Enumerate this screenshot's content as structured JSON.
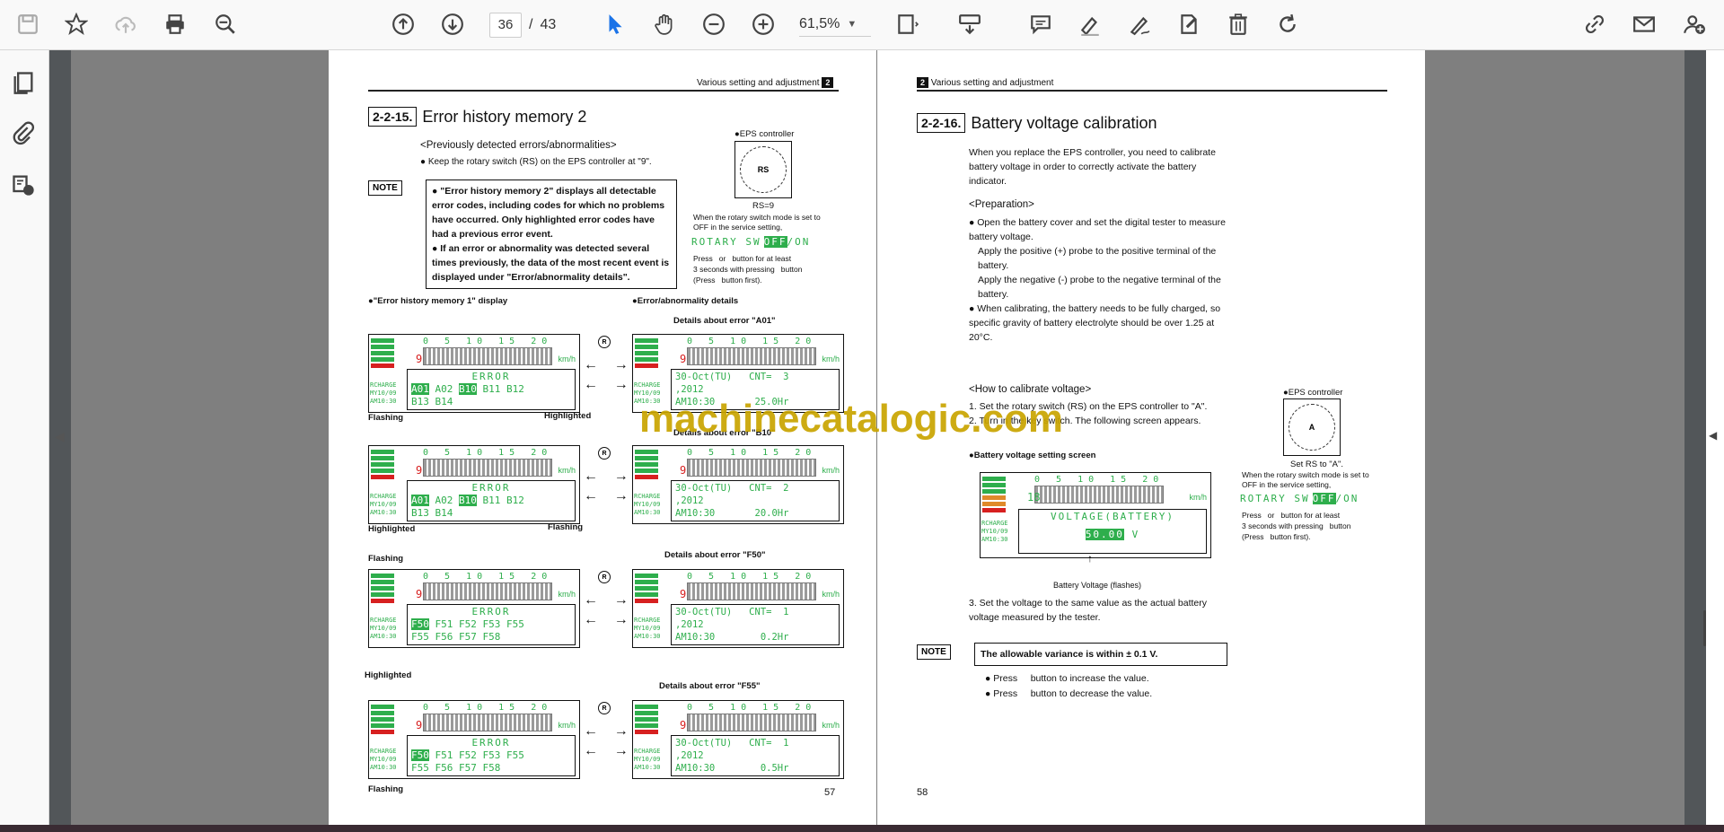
{
  "toolbar": {
    "left_icons": [
      "save-icon",
      "bookmark-star-icon",
      "cloud-upload-icon",
      "print-icon",
      "zoom-search-icon"
    ],
    "nav_icons": [
      "page-up-icon",
      "page-down-icon"
    ],
    "current_page": "36",
    "page_separator": "/",
    "total_pages": "43",
    "tool_icons": [
      "select-cursor-icon",
      "hand-pan-icon",
      "zoom-out-icon",
      "zoom-in-icon"
    ],
    "zoom_level": "61,5%",
    "right_icons": [
      "fit-page-icon",
      "scroll-mode-icon",
      "comment-icon",
      "highlight-pen-icon",
      "draw-icon",
      "stamp-icon",
      "delete-icon",
      "rotate-icon",
      "share-link-icon",
      "email-icon",
      "add-user-icon"
    ]
  },
  "sidebar": {
    "icons": [
      "page-thumbnails-icon",
      "attachments-icon",
      "layers-icon"
    ]
  },
  "left_page": {
    "header": "Various setting and adjustment",
    "header_badge": "2",
    "section_number": "2-2-15.",
    "section_title": "Error history memory 2",
    "subheading": "<Previously detected errors/abnormalities>",
    "bullet_1": "Keep the rotary switch (RS) on the EPS controller at \"9\".",
    "eps_label": "●EPS controller",
    "rs_label": "RS=9",
    "rotary_note": "When the rotary switch mode is set to OFF in the service setting,",
    "rotary_sw": "ROTARY SW",
    "rotary_off": "OFF",
    "rotary_on": "/ON",
    "press_note_1": "Press   or   button for at least",
    "press_note_2": "3 seconds with pressing   button",
    "press_note_3": "(Press   button first).",
    "note_tag": "NOTE",
    "note_1": "\"Error history memory 2\" displays all detectable error codes, including codes for which no problems have occurred. Only highlighted error codes have had a previous error event.",
    "note_2": "If an error or abnormality was detected several times previously, the data of the most recent event is displayed under \"Error/abnormality details\".",
    "col_left_title": "●\"Error history memory 1\" display",
    "col_right_title": "●Error/abnormality details",
    "details_a01": "Details about error \"A01\"",
    "details_b10": "Details about error \"B10\"",
    "details_f50": "Details about error \"F50\"",
    "details_f55": "Details about error \"F55\"",
    "label_flashing": "Flashing",
    "label_highlighted": "Highlighted",
    "page_number": "57"
  },
  "lcd_common": {
    "scale": "0 5 10 15 20",
    "unit": "km/h",
    "digit": "9",
    "side_text": "RCHARGE\nMY10/09\nAM10:30",
    "error_title": "ERROR"
  },
  "lcd_rows": [
    {
      "left_line1": [
        "A01",
        "A02",
        "B10",
        "B11",
        "B12"
      ],
      "left_line2": "B13 B14",
      "right_line1": "30-Oct(TU)   CNT=  3",
      "right_line2": ",2012",
      "right_line3": "AM10:30       25.0Hr"
    },
    {
      "left_line1": [
        "A01",
        "A02",
        "B10",
        "B11",
        "B12"
      ],
      "left_line2": "B13 B14",
      "right_line1": "30-Oct(TU)   CNT=  2",
      "right_line2": ",2012",
      "right_line3": "AM10:30       20.0Hr"
    },
    {
      "left_line1": [
        "F50",
        "F51",
        "F52",
        "F53",
        "F55"
      ],
      "left_line2": "F55 F56 F57 F58",
      "right_line1": "30-Oct(TU)   CNT=  1",
      "right_line2": ",2012",
      "right_line3": "AM10:30        0.2Hr"
    },
    {
      "left_line1": [
        "F50",
        "F51",
        "F52",
        "F53",
        "F55"
      ],
      "left_line2": "F55 F56 F57 F58",
      "right_line1": "30-Oct(TU)   CNT=  1",
      "right_line2": ",2012",
      "right_line3": "AM10:30        0.5Hr"
    }
  ],
  "right_page": {
    "header_badge": "2",
    "header": "Various setting and adjustment",
    "section_number": "2-2-16.",
    "section_title": "Battery voltage calibration",
    "intro": "When you replace the EPS controller, you need to calibrate battery voltage in order to correctly activate the battery indicator.",
    "prep_heading": "<Preparation>",
    "prep_1": "Open the battery cover and set the digital tester to measure battery voltage.",
    "prep_1b": "Apply the positive (+) probe to the positive terminal of the battery.",
    "prep_1c": "Apply the negative (-) probe to the negative terminal of the battery.",
    "prep_2": "When calibrating, the battery needs to be fully charged, so specific gravity of battery electrolyte should be over 1.25 at 20°C.",
    "how_heading": "<How to calibrate voltage>",
    "step_1": "1. Set the rotary switch (RS) on the EPS controller to \"A\".",
    "step_2": "2. Turn in the key switch. The following screen appears.",
    "screen_label": "●Battery voltage setting screen",
    "lcd_title": "VOLTAGE(BATTERY)",
    "lcd_value": "50.00",
    "lcd_unit": "V",
    "lcd_digit": "18",
    "flash_caption": "Battery Voltage (flashes)",
    "step_3": "3. Set the voltage to the same value as the actual battery voltage measured by the tester.",
    "eps_label": "●EPS controller",
    "rs_label": "Set RS to \"A\".",
    "rotary_note": "When the rotary switch mode is set to OFF in the service setting,",
    "rotary_sw": "ROTARY SW",
    "rotary_off": "OFF",
    "rotary_on": "/ON",
    "press_note_1": "Press   or   button for at least",
    "press_note_2": "3 seconds with pressing   button",
    "press_note_3": "(Press   button first).",
    "note_tag": "NOTE",
    "note_text": "The allowable variance is within ± 0.1 V.",
    "bullet_inc": "Press     button to increase the value.",
    "bullet_dec": "Press     button to decrease the value.",
    "page_number": "58"
  },
  "watermark": "machinecatalogic.com",
  "colors": {
    "lcd_green": "#2eae4c",
    "lcd_red": "#d72020",
    "watermark": "#c9a400",
    "viewer_bg": "#7f7f7f"
  }
}
